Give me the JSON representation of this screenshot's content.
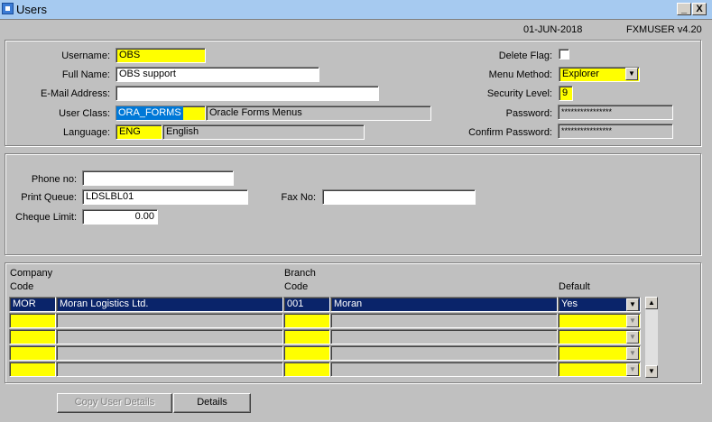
{
  "window": {
    "title": "Users",
    "minimize_glyph": "_",
    "close_glyph": "X"
  },
  "header": {
    "date": "01-JUN-2018",
    "module": "FXMUSER  v4.20"
  },
  "user": {
    "username_label": "Username:",
    "username": "OBS",
    "fullname_label": "Full Name:",
    "fullname": "OBS support",
    "email_label": "E-Mail Address:",
    "email": "",
    "userclass_label": "User Class:",
    "userclass_code": "ORA_FORMS",
    "userclass_desc": "Oracle Forms Menus",
    "language_label": "Language:",
    "language_code": "ENG",
    "language_desc": "English",
    "deleteflag_label": "Delete Flag:",
    "menumethod_label": "Menu Method:",
    "menumethod": "Explorer",
    "securitylevel_label": "Security Level:",
    "securitylevel": "9",
    "password_label": "Password:",
    "password": "****************",
    "confirm_label": "Confirm Password:",
    "confirm": "****************"
  },
  "contact": {
    "phone_label": "Phone no:",
    "phone": "",
    "printqueue_label": "Print Queue:",
    "printqueue": "LDSLBL01",
    "fax_label": "Fax No:",
    "fax": "",
    "chequelimit_label": "Cheque Limit:",
    "chequelimit": "0.00"
  },
  "grid": {
    "company_header_1": "Company",
    "company_header_2": "Code",
    "branch_header_1": "Branch",
    "branch_header_2": "Code",
    "default_header": "Default",
    "rows": [
      {
        "company_code": "MOR",
        "company_name": "Moran Logistics Ltd.",
        "branch_code": "001",
        "branch_name": "Moran",
        "default": "Yes"
      },
      {
        "company_code": "",
        "company_name": "",
        "branch_code": "",
        "branch_name": "",
        "default": ""
      },
      {
        "company_code": "",
        "company_name": "",
        "branch_code": "",
        "branch_name": "",
        "default": ""
      },
      {
        "company_code": "",
        "company_name": "",
        "branch_code": "",
        "branch_name": "",
        "default": ""
      },
      {
        "company_code": "",
        "company_name": "",
        "branch_code": "",
        "branch_name": "",
        "default": ""
      }
    ]
  },
  "buttons": {
    "copy_user_details": "Copy User Details",
    "details": "Details"
  }
}
